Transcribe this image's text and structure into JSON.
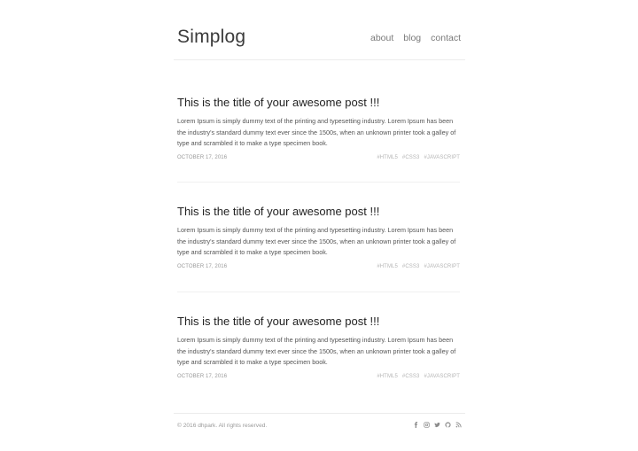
{
  "header": {
    "logo": "Simplog",
    "nav": [
      "about",
      "blog",
      "contact"
    ]
  },
  "posts": [
    {
      "title": "This is the title of your awesome post !!!",
      "body": "Lorem Ipsum is simply dummy text of the printing and typesetting industry. Lorem Ipsum has been the industry's standard dummy text ever since the 1500s, when an unknown printer took a galley of type and scrambled it to make a type specimen book.",
      "date": "OCTOBER 17, 2016",
      "tags": [
        "#HTML5",
        "#CSS3",
        "#JAVASCRIPT"
      ]
    },
    {
      "title": "This is the title of your awesome post !!!",
      "body": "Lorem Ipsum is simply dummy text of the printing and typesetting industry. Lorem Ipsum has been the industry's standard dummy text ever since the 1500s, when an unknown printer took a galley of type and scrambled it to make a type specimen book.",
      "date": "OCTOBER 17, 2016",
      "tags": [
        "#HTML5",
        "#CSS3",
        "#JAVASCRIPT"
      ]
    },
    {
      "title": "This is the title of your awesome post !!!",
      "body": "Lorem Ipsum is simply dummy text of the printing and typesetting industry. Lorem Ipsum has been the industry's standard dummy text ever since the 1500s, when an unknown printer took a galley of type and scrambled it to make a type specimen book.",
      "date": "OCTOBER 17, 2016",
      "tags": [
        "#HTML5",
        "#CSS3",
        "#JAVASCRIPT"
      ]
    }
  ],
  "footer": {
    "copyright": "© 2016 dhpark. All rights reserved.",
    "social_icons": [
      "facebook-icon",
      "instagram-icon",
      "twitter-icon",
      "github-icon",
      "rss-icon"
    ]
  }
}
